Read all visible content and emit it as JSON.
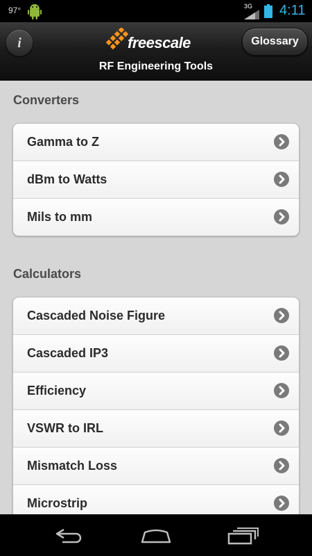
{
  "status_bar": {
    "temperature": "97°",
    "network_type": "3G",
    "time": "4:11",
    "icons": [
      "android-icon",
      "signal-icon",
      "battery-icon"
    ]
  },
  "header": {
    "info_icon": "i",
    "logo_text": "freescale",
    "subtitle": "RF Engineering Tools",
    "glossary_label": "Glossary"
  },
  "converters": {
    "title": "Converters",
    "items": [
      {
        "label": "Gamma to Z"
      },
      {
        "label": "dBm to Watts"
      },
      {
        "label": "Mils to mm"
      }
    ]
  },
  "calculators": {
    "title": "Calculators",
    "items": [
      {
        "label": "Cascaded Noise Figure"
      },
      {
        "label": "Cascaded IP3"
      },
      {
        "label": "Efficiency"
      },
      {
        "label": "VSWR to IRL"
      },
      {
        "label": "Mismatch Loss"
      },
      {
        "label": "Microstrip"
      }
    ]
  },
  "colors": {
    "accent_time": "#33b5e5",
    "logo_orange": "#f7941d",
    "background": "#d6d6d6"
  }
}
